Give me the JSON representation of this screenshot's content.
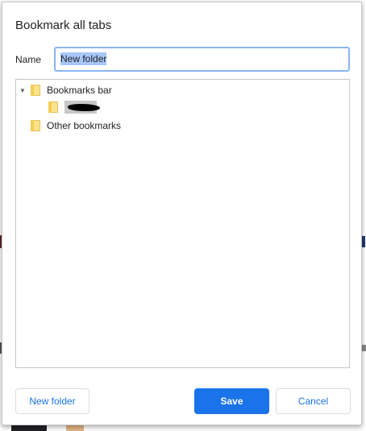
{
  "dialog": {
    "title": "Bookmark all tabs",
    "name_label": "Name",
    "name_value": "New folder"
  },
  "tree": {
    "items": [
      {
        "label": "Bookmarks bar",
        "icon": "folder-icon",
        "expanded": true
      },
      {
        "label": "",
        "icon": "folder-icon",
        "redacted": true
      },
      {
        "label": "Other bookmarks",
        "icon": "folder-icon"
      }
    ]
  },
  "buttons": {
    "new_folder": "New folder",
    "save": "Save",
    "cancel": "Cancel"
  },
  "colors": {
    "primary": "#1a73e8",
    "focus_ring": "#8ab4f8",
    "selection": "#a8c7fa",
    "folder": "#fbe38e"
  }
}
